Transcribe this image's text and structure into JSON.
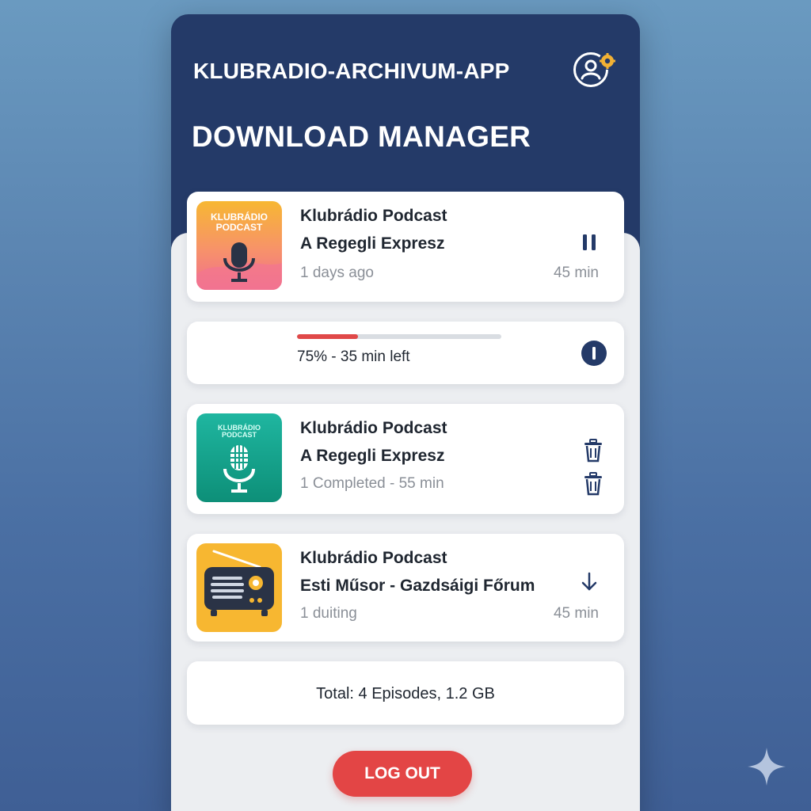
{
  "header": {
    "app_title": "KLUBRADIO-ARCHIVUM-APP",
    "page_title": "DOWNLOAD MANAGER"
  },
  "downloads": [
    {
      "thumb_text": "KLUBRÁDIO\nPODCAST",
      "title": "Klubrádio Podcast",
      "episode": "A Regegli Expresz",
      "meta": "1 days ago",
      "duration": "45 min",
      "action_icon": "pause-icon"
    },
    {
      "thumb_text": "KLUBRÁDIO\nPODCAST",
      "title": "Klubrádio Podcast",
      "episode": "A Regegli Expresz",
      "meta": "1 Completed - 55 min",
      "action_icon": "trash-icon"
    },
    {
      "title": "Klubrádio Podcast",
      "episode": "Esti Műsor - Gazdsáigi Főrum",
      "meta": "1 duiting",
      "duration": "45 min",
      "action_icon": "download-arrow-icon"
    }
  ],
  "progress": {
    "text": "75% - 35 min left",
    "bar_fraction": 0.3,
    "action_icon": "stop-icon"
  },
  "summary": {
    "total": "Total: 4 Episodes, 1.2 GB"
  },
  "logout_label": "LOG OUT",
  "colors": {
    "header_bg": "#243a68",
    "accent_red": "#e34545",
    "progress_fill": "#e04848",
    "card_bg": "#ffffff",
    "sheet_bg": "#eceef1"
  }
}
